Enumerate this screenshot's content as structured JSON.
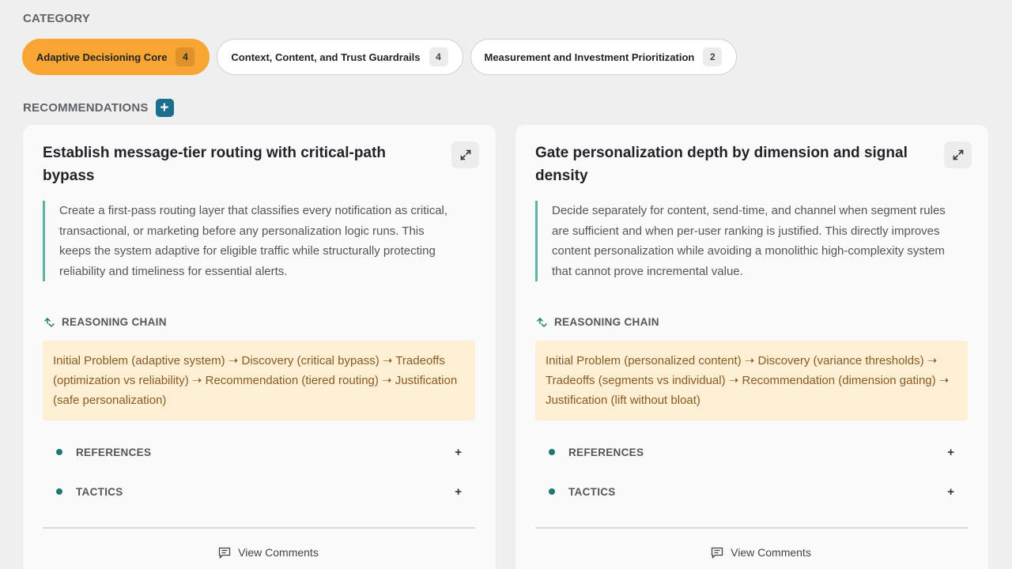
{
  "category": {
    "label": "CATEGORY",
    "pills": [
      {
        "label": "Adaptive Decisioning Core",
        "count": "4",
        "active": true
      },
      {
        "label": "Context, Content, and Trust Guardrails",
        "count": "4",
        "active": false
      },
      {
        "label": "Measurement and Investment Prioritization",
        "count": "2",
        "active": false
      }
    ]
  },
  "recommendations": {
    "label": "RECOMMENDATIONS",
    "add_icon": "plus-icon",
    "cards": [
      {
        "title": "Establish message-tier routing with critical-path bypass",
        "description": "Create a first-pass routing layer that classifies every notification as critical, transactional, or marketing before any personalization logic runs. This keeps the system adaptive for eligible traffic while structurally protecting reliability and timeliness for essential alerts.",
        "reasoning_label": "REASONING CHAIN",
        "reasoning": "Initial Problem (adaptive system) ➝ Discovery (critical bypass) ➝ Tradeoffs (optimization vs reliability) ➝ Recommendation (tiered routing) ➝ Justification (safe personalization)",
        "references_label": "REFERENCES",
        "tactics_label": "TACTICS",
        "comments_label": "View Comments"
      },
      {
        "title": "Gate personalization depth by dimension and signal density",
        "description": "Decide separately for content, send-time, and channel when segment rules are sufficient and when per-user ranking is justified. This directly improves content personalization while avoiding a monolithic high-complexity system that cannot prove incremental value.",
        "reasoning_label": "REASONING CHAIN",
        "reasoning": "Initial Problem (personalized content) ➝ Discovery (variance thresholds) ➝ Tradeoffs (segments vs individual) ➝ Recommendation (dimension gating) ➝ Justification (lift without bloat)",
        "references_label": "REFERENCES",
        "tactics_label": "TACTICS",
        "comments_label": "View Comments"
      }
    ]
  },
  "colors": {
    "accent_orange": "#f8a534",
    "teal": "#1d7a6b",
    "add_button": "#1a6f8e",
    "reasoning_bg": "#fdefd4"
  }
}
